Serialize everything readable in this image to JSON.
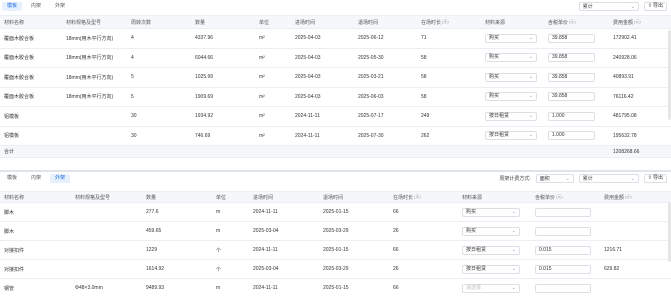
{
  "top": {
    "tabs": [
      "模板",
      "内架",
      "外架"
    ],
    "active_tab": 0,
    "period_select": "累计",
    "export_label": "导出",
    "columns": [
      "材料名称",
      "材料规格及型号",
      "周转次数",
      "数量",
      "单位",
      "进场时间",
      "退场时间",
      "在场时长",
      "材料来源",
      "含税单价",
      "费用金额"
    ],
    "column_units": {
      "在场时长": "(天)",
      "含税单价": "(元)",
      "费用金额": "(元)"
    },
    "rows": [
      [
        "覆面木胶合板",
        "18mm(用木平行方向)",
        "4",
        "4337.96",
        "m²",
        "2025-04-03",
        "2025-06-12",
        "71",
        "购买",
        "39.858",
        "172902.41"
      ],
      [
        "覆面木胶合板",
        "18mm(用木平行方向)",
        "4",
        "6044.66",
        "m²",
        "2025-04-03",
        "2025-05-30",
        "58",
        "购买",
        "39.858",
        "240928.06"
      ],
      [
        "覆面木胶合板",
        "18mm(用木平行方向)",
        "5",
        "1025.99",
        "m²",
        "2025-04-03",
        "2025-03-21",
        "58",
        "购买",
        "39.858",
        "40893.91"
      ],
      [
        "覆面木胶合板",
        "18mm(用木平行方向)",
        "5",
        "1909.69",
        "m²",
        "2025-04-03",
        "2025-06-03",
        "58",
        "购买",
        "39.858",
        "76116.42"
      ],
      [
        "铝模板",
        "",
        "30",
        "1934.92",
        "m²",
        "2024-11-11",
        "2025-07-17",
        "249",
        "按日租赁",
        "1.000",
        "481795.08"
      ],
      [
        "铝模板",
        "",
        "30",
        "746.69",
        "m²",
        "2024-11-11",
        "2025-07-30",
        "262",
        "按日租赁",
        "1.000",
        "195632.78"
      ]
    ],
    "summary_label": "合计",
    "summary_total": "1208268.66"
  },
  "bottom": {
    "tabs": [
      "模板",
      "内架",
      "外架"
    ],
    "active_tab": 2,
    "method_label": "周架计费方式:",
    "method_select": "面积",
    "period_select": "累计",
    "export_label": "导出",
    "columns": [
      "材料名称",
      "材料规格及型号",
      "数量",
      "单位",
      "进场时间",
      "退场时间",
      "在场时长",
      "材料来源",
      "含税单价",
      "费用金额"
    ],
    "column_units": {
      "在场时长": "(天)",
      "含税单价": "(元)",
      "费用金额": "(元)"
    },
    "rows": [
      [
        "脚木",
        "",
        "277.6",
        "m",
        "2024-11-11",
        "2025-01-15",
        "66",
        "购买",
        "",
        ""
      ],
      [
        "脚木",
        "",
        "459.65",
        "m",
        "2025-03-04",
        "2025-03-29",
        "26",
        "购买",
        "",
        ""
      ],
      [
        "对接扣件",
        "",
        "1229",
        "个",
        "2024-11-11",
        "2025-01-15",
        "66",
        "按日租赁",
        "0.015",
        "1216.71"
      ],
      [
        "对接扣件",
        "",
        "1614.92",
        "个",
        "2025-03-04",
        "2025-03-29",
        "26",
        "按日租赁",
        "0.015",
        "629.82"
      ],
      [
        "钢管",
        "Φ48×3.0mm",
        "9489.93",
        "m",
        "2024-11-11",
        "2025-01-15",
        "66",
        "请选择",
        "",
        ""
      ]
    ]
  }
}
